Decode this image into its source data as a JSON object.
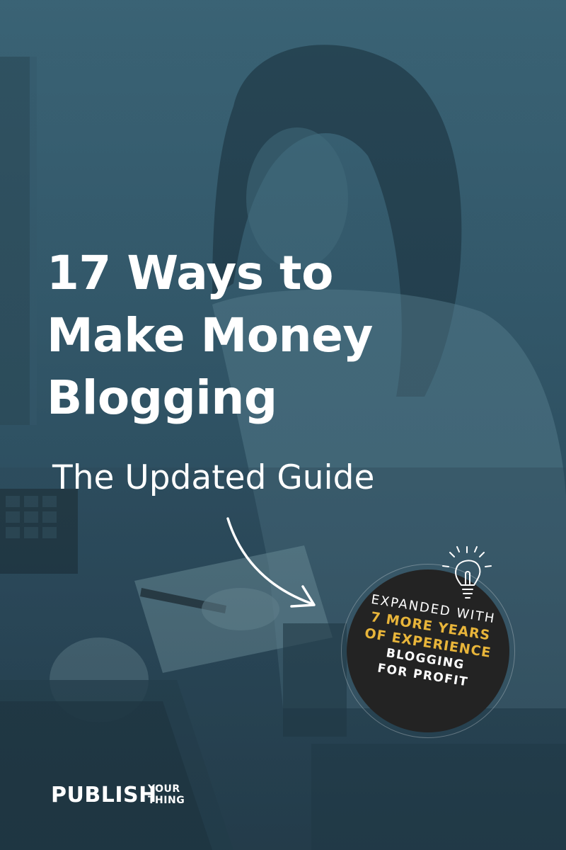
{
  "headline": {
    "lines": [
      "17 Ways to",
      "Make Money",
      "Blogging"
    ]
  },
  "subtitle": "The Updated Guide",
  "badge": {
    "line1": "EXPANDED WITH",
    "line2": "7 MORE YEARS",
    "line3": "OF EXPERIENCE",
    "line4": "BLOGGING",
    "line5": "FOR PROFIT",
    "icon": "lightbulb-icon"
  },
  "brand": {
    "name": "PUBLISH",
    "tagline_top": "YOUR",
    "tagline_bottom": "THING"
  },
  "colors": {
    "overlay": "#33586a",
    "badge_bg": "#232323",
    "accent": "#e8b53a",
    "text": "#ffffff"
  }
}
